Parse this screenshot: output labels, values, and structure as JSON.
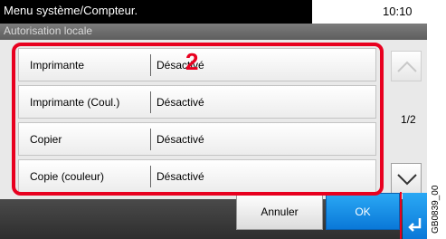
{
  "header": {
    "menu_title": "Menu système/Compteur.",
    "time": "10:10",
    "subtitle": "Autorisation locale"
  },
  "rows": [
    {
      "label": "Imprimante",
      "value": "Désactivé"
    },
    {
      "label": "Imprimante (Coul.)",
      "value": "Désactivé"
    },
    {
      "label": "Copier",
      "value": "Désactivé"
    },
    {
      "label": "Copie (couleur)",
      "value": "Désactivé"
    }
  ],
  "pagination": {
    "indicator": "1/2"
  },
  "buttons": {
    "cancel": "Annuler",
    "ok": "OK"
  },
  "annotation": {
    "step": "2",
    "figure_code": "GB0839_00"
  },
  "colors": {
    "highlight": "#e8001f",
    "ok_blue": "#0a78d8"
  },
  "icons": {
    "scroll_up": "chevron-up-icon",
    "scroll_down": "chevron-down-icon",
    "enter": "enter-return-icon"
  }
}
